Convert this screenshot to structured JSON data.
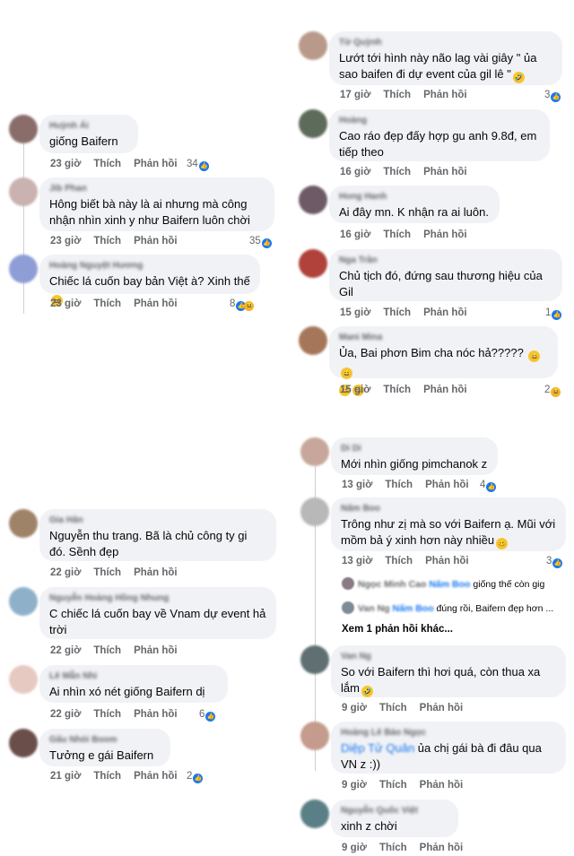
{
  "actions": {
    "like": "Thích",
    "reply": "Phản hồi"
  },
  "colors": {
    "bubble": "#f0f2f5",
    "like": "#1877f2",
    "haha": "#f7b125",
    "meta": "#65676b"
  },
  "left_top": [
    {
      "author": "Huỳnh Ái",
      "text": "giống Baifern",
      "time": "23 giờ",
      "reacts": "34"
    },
    {
      "author": "Jib Phan",
      "text": "Hông biết bà này là ai nhưng mà công nhận nhìn xinh y như Baifern luôn chời",
      "time": "23 giờ",
      "reacts": "35"
    },
    {
      "author": "Hoàng Nguyệt Hương",
      "text": "Chiếc lá cuốn bay bản Việt à? Xinh thế",
      "time": "23 giờ",
      "reacts": "8"
    }
  ],
  "right_top": [
    {
      "author": "Từ Quỳnh",
      "text": "Lướt tới hình này não lag vài giây \" ủa sao baifen đi dự event của gil lê \"",
      "time": "17 giờ",
      "reacts": "3"
    },
    {
      "author": "Hoàng",
      "text": "Cao ráo đẹp đấy hợp gu anh 9.8đ, em tiếp theo",
      "time": "16 giờ",
      "reacts": ""
    },
    {
      "author": "Hong Hanh",
      "text": "Ai đây mn. K nhận ra ai luôn.",
      "time": "16 giờ",
      "reacts": ""
    },
    {
      "author": "Nga Trần",
      "text": "Chủ tịch đó, đứng sau thương hiệu của Gil",
      "time": "15 giờ",
      "reacts": "1"
    },
    {
      "author": "Mani Mina",
      "text": "Ủa, Bai phơn Bim cha nóc hả?????",
      "time": "15 giờ",
      "reacts": "2"
    }
  ],
  "left_bottom": [
    {
      "author": "Gia Hân",
      "text": "Nguyễn thu trang. Bã là chủ công ty gi đó. Sềnh đẹp",
      "time": "22 giờ",
      "reacts": ""
    },
    {
      "author": "Nguyễn Hoàng Hồng Nhung",
      "text": "C chiếc lá cuốn bay về Vnam dự event hả trời",
      "time": "22 giờ",
      "reacts": ""
    },
    {
      "author": "Lê Mẫn Nhi",
      "text": "Ai nhìn xó nét giống Baifern dị",
      "time": "22 giờ",
      "reacts": "6"
    },
    {
      "author": "Gấu Nhỏi Boom",
      "text": "Tưởng e gái Baifern",
      "time": "21 giờ",
      "reacts": "2"
    }
  ],
  "right_bottom": [
    {
      "author": "Di Di",
      "text": "Mới nhìn giống pimchanok z",
      "time": "13 giờ",
      "reacts": "4"
    },
    {
      "author": "Nấm Boo",
      "text": "Trông như zị mà so với Baifern ạ. Mũi với mồm bả ý xinh hơn này nhiều",
      "time": "13 giờ",
      "reacts": "3"
    },
    {
      "author": "Van Ng",
      "text": "So với Baifern thì hơi quá, còn thua xa lắm",
      "time": "9 giờ",
      "reacts": ""
    },
    {
      "author": "Hoàng Lê Bảo Ngọc",
      "mention": "Diệp Tử Quân",
      "text": "ủa chị gái bà đi đâu qua VN z :))",
      "time": "9 giờ",
      "reacts": ""
    },
    {
      "author": "Nguyễn Quốc Việt",
      "text": "xinh z chời",
      "time": "9 giờ",
      "reacts": ""
    }
  ],
  "replies": [
    {
      "author": "Ngọc Minh Cao",
      "tag": "Nấm Boo",
      "text": "giống thế còn gig"
    },
    {
      "author": "Van Ng",
      "tag": "Nấm Boo",
      "text": "đúng rồi, Baifern đẹp hơn ..."
    }
  ],
  "more_replies": "Xem 1 phản hồi khác..."
}
